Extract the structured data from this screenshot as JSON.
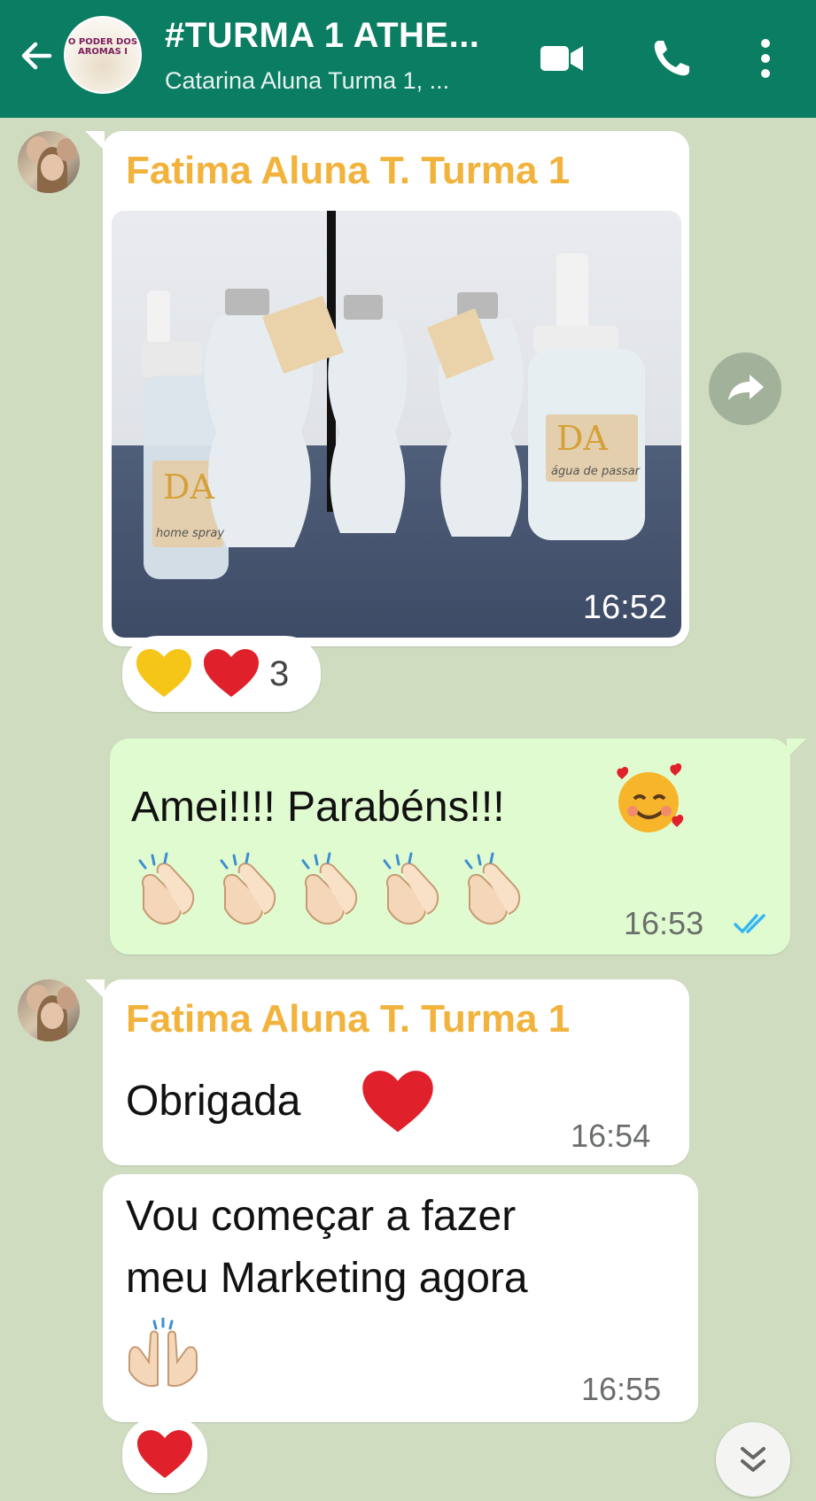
{
  "header": {
    "title": "#TURMA 1 ATHE...",
    "subtitle": "Catarina Aluna Turma 1, ...",
    "group_avatar_text": "O PODER DOS AROMAS I"
  },
  "messages": [
    {
      "sender": "Fatima Aluna T. Turma 1",
      "type": "image",
      "time": "16:52",
      "reaction_count": "3",
      "image_labels": [
        "DA",
        "home spray",
        "água de passar"
      ]
    },
    {
      "type": "outgoing",
      "text": "Amei!!!! Parabéns!!!",
      "time": "16:53"
    },
    {
      "sender": "Fatima Aluna T. Turma 1",
      "text": "Obrigada",
      "time": "16:54"
    },
    {
      "text_line1": "Vou começar a fazer",
      "text_line2": "meu Marketing agora",
      "time": "16:55"
    }
  ],
  "icons": {
    "back": "arrow-left-icon",
    "video": "video-camera-icon",
    "call": "phone-icon",
    "menu": "more-vertical-icon",
    "forward": "forward-arrow-icon",
    "scroll": "double-chevron-down-icon"
  },
  "colors": {
    "header": "#0b7d62",
    "chat_background": "#cfdcbf",
    "sender_name": "#f2b33d",
    "outgoing_bubble": "#e1fbd1",
    "read_ticks": "#34b7f1"
  }
}
